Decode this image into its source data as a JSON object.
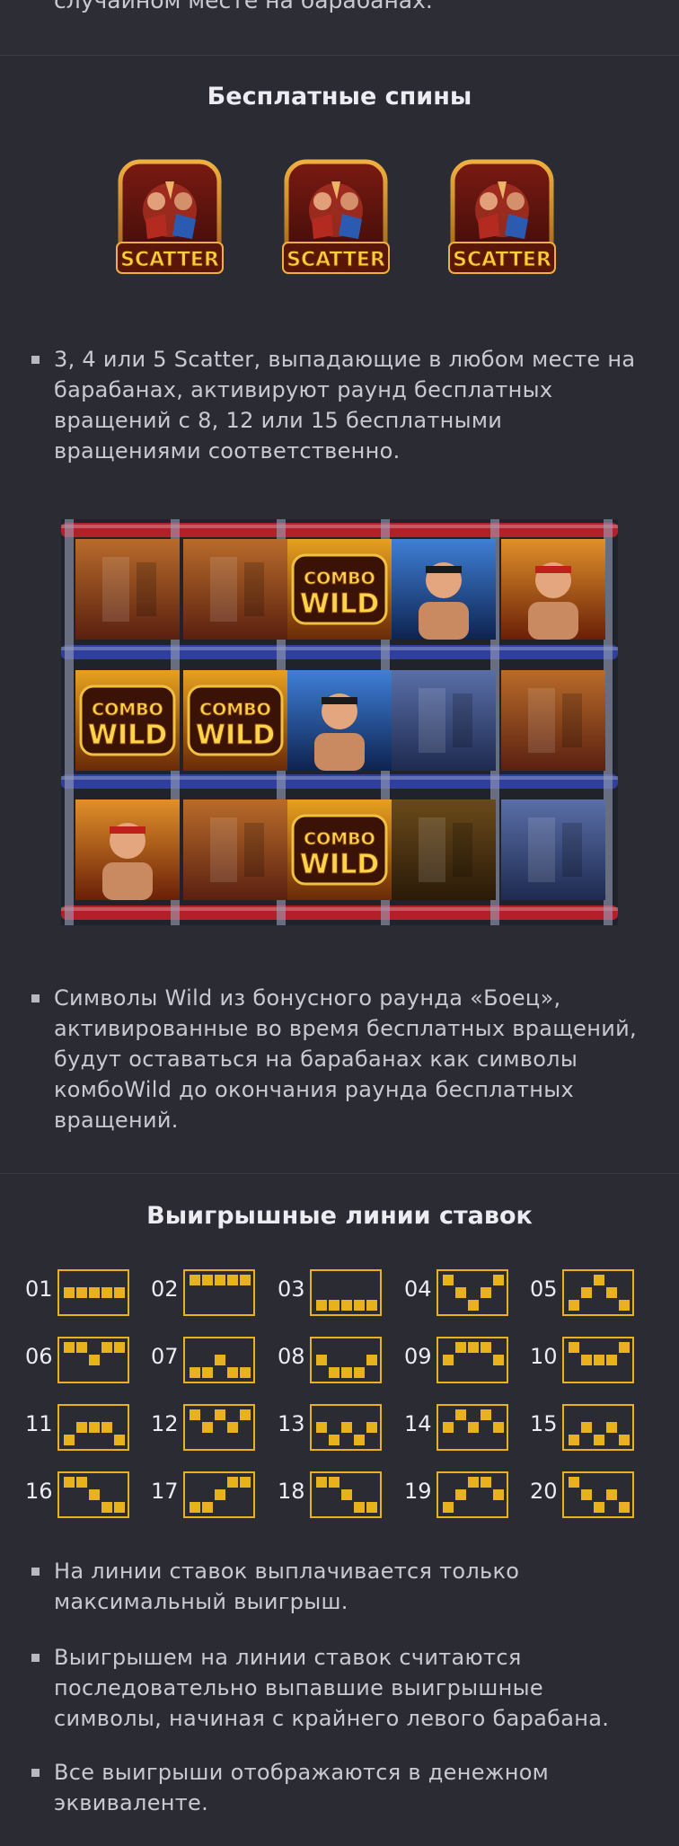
{
  "top_text": "случайном месте на барабанах.",
  "free_spins": {
    "title": "Бесплатные спины",
    "scatter_label": "SCATTER",
    "scatter_count": 3,
    "bullet": "3, 4 или 5 Scatter, выпадающие в любом месте на барабанах, активируют раунд бесплатных вращений с 8, 12 или 15 бесплатными вращениями соответственно."
  },
  "reel_grid": {
    "combo_wild_label_1": "COMBO",
    "combo_wild_label_2": "WILD",
    "cells": [
      [
        "blur-red",
        "blur-red",
        "combo-wild",
        "fighter-blue",
        "fighter-red"
      ],
      [
        "combo-wild",
        "combo-wild",
        "fighter-blue",
        "blur-blue",
        "blur-red"
      ],
      [
        "fighter-red",
        "blur-red",
        "combo-wild",
        "blur-gold",
        "blur-blue"
      ]
    ]
  },
  "wild_bullet": "Символы Wild из бонусного раунда «Боец», активированные во время бесплатных вращений, будут оставаться на барабанах как символы комбоWild до окончания раунда бесплатных вращений.",
  "paylines": {
    "title": "Выигрышные линии ставок",
    "lines": [
      {
        "num": "01",
        "rows": [
          1,
          1,
          1,
          1,
          1
        ]
      },
      {
        "num": "02",
        "rows": [
          0,
          0,
          0,
          0,
          0
        ]
      },
      {
        "num": "03",
        "rows": [
          2,
          2,
          2,
          2,
          2
        ]
      },
      {
        "num": "04",
        "rows": [
          0,
          1,
          2,
          1,
          0
        ]
      },
      {
        "num": "05",
        "rows": [
          2,
          1,
          0,
          1,
          2
        ]
      },
      {
        "num": "06",
        "rows": [
          0,
          0,
          1,
          0,
          0
        ]
      },
      {
        "num": "07",
        "rows": [
          2,
          2,
          1,
          2,
          2
        ]
      },
      {
        "num": "08",
        "rows": [
          1,
          2,
          2,
          2,
          1
        ]
      },
      {
        "num": "09",
        "rows": [
          1,
          0,
          0,
          0,
          1
        ]
      },
      {
        "num": "10",
        "rows": [
          0,
          1,
          1,
          1,
          0
        ]
      },
      {
        "num": "11",
        "rows": [
          2,
          1,
          1,
          1,
          2
        ]
      },
      {
        "num": "12",
        "rows": [
          0,
          1,
          0,
          1,
          0
        ]
      },
      {
        "num": "13",
        "rows": [
          1,
          2,
          1,
          2,
          1
        ]
      },
      {
        "num": "14",
        "rows": [
          1,
          0,
          1,
          0,
          1
        ]
      },
      {
        "num": "15",
        "rows": [
          2,
          1,
          2,
          1,
          2
        ]
      },
      {
        "num": "16",
        "rows": [
          0,
          0,
          1,
          2,
          2
        ]
      },
      {
        "num": "17",
        "rows": [
          2,
          2,
          1,
          0,
          0
        ]
      },
      {
        "num": "18",
        "rows": [
          0,
          0,
          1,
          2,
          2
        ]
      },
      {
        "num": "19",
        "rows": [
          2,
          1,
          0,
          0,
          1
        ]
      },
      {
        "num": "20",
        "rows": [
          0,
          1,
          2,
          1,
          2
        ]
      }
    ],
    "box_color": "#e8b21d"
  },
  "notes": [
    "На линии ставок выплачивается только максимальный выигрыш.",
    "Выигрышем на линии ставок считаются последовательно выпавшие выигрышные символы, начиная с крайнего левого барабана.",
    "Все выигрыши отображаются в денежном эквиваленте."
  ]
}
